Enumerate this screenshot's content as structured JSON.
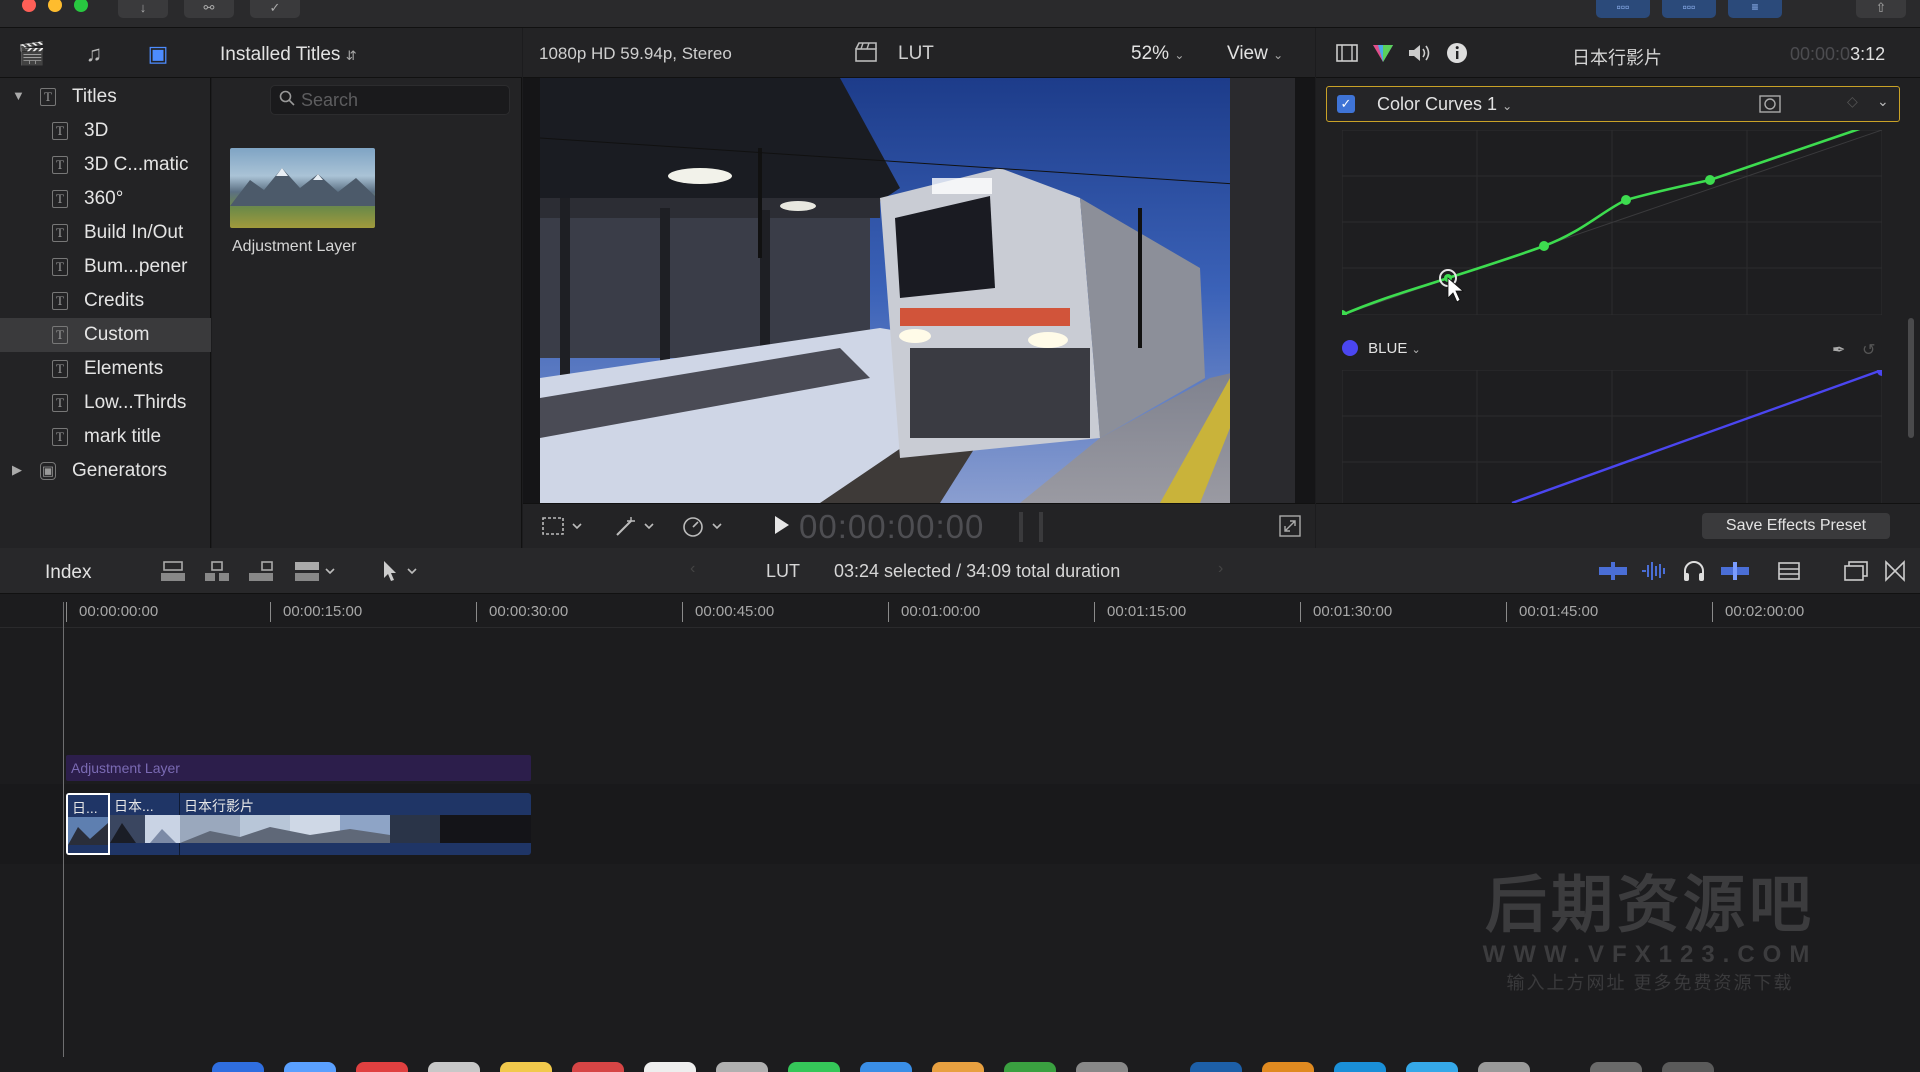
{
  "browser": {
    "title": "Installed Titles",
    "search_placeholder": "Search",
    "sidebar": [
      {
        "label": "Titles",
        "type": "group",
        "expanded": true
      },
      {
        "label": "3D"
      },
      {
        "label": "3D C...matic"
      },
      {
        "label": "360°"
      },
      {
        "label": "Build In/Out"
      },
      {
        "label": "Bum...pener"
      },
      {
        "label": "Credits"
      },
      {
        "label": "Custom",
        "selected": true
      },
      {
        "label": "Elements"
      },
      {
        "label": "Low...Thirds"
      },
      {
        "label": "mark title"
      },
      {
        "label": "Generators",
        "type": "group",
        "expanded": false
      }
    ],
    "items": [
      {
        "label": "Adjustment Layer"
      }
    ]
  },
  "viewer": {
    "format": "1080p HD 59.94p, Stereo",
    "lut_label": "LUT",
    "zoom": "52%",
    "view_label": "View",
    "timecode": "00:00:00:00"
  },
  "inspector": {
    "clip_name": "日本行影片",
    "timecode_dim": "00:00:0",
    "timecode_bright": "3:12",
    "effect_name": "Color Curves 1",
    "channel_label": "BLUE",
    "save_button": "Save Effects Preset",
    "colors": {
      "green_curve": "#3ddc4f",
      "blue_curve": "#4b46f0",
      "highlight": "#c9a227"
    }
  },
  "timeline": {
    "index_label": "Index",
    "lut_label": "LUT",
    "status": "03:24 selected / 34:09 total duration",
    "ruler": [
      "00:00:00:00",
      "00:00:15:00",
      "00:00:30:00",
      "00:00:45:00",
      "00:01:00:00",
      "00:01:15:00",
      "00:01:30:00",
      "00:01:45:00",
      "00:02:00:00"
    ],
    "adjustment_layer": "Adjustment Layer",
    "clips": [
      {
        "title": "日..."
      },
      {
        "title": "日本..."
      },
      {
        "title": "日本行影片"
      }
    ]
  },
  "watermark": {
    "title": "后期资源吧",
    "url": "WWW.VFX123.COM",
    "subtitle": "输入上方网址 更多免费资源下载"
  }
}
